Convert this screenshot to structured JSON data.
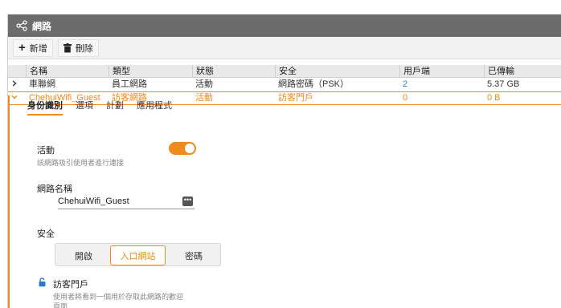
{
  "window": {
    "title": "網路"
  },
  "toolbar": {
    "add_label": "新增",
    "delete_label": "刪除"
  },
  "table": {
    "columns": [
      "名稱",
      "類型",
      "狀態",
      "安全",
      "用戶端",
      "已傳輸"
    ],
    "rows": [
      {
        "name": "車聯網",
        "type": "員工網路",
        "status": "活動",
        "security": "網路密碼（PSK）",
        "clients": "2",
        "transferred": "5.37 GB"
      },
      {
        "name": "ChehuiWifi_Guest",
        "type": "訪客網路",
        "status": "活動",
        "security": "訪客門戶",
        "clients": "0",
        "transferred": "0 B"
      }
    ]
  },
  "detail": {
    "tabs": [
      "身份識別",
      "選項",
      "計劃",
      "應用程式"
    ],
    "active_label": "活動",
    "active_hint": "該網路吸引使用者進行連接",
    "active_state": "on",
    "network_name_label": "網路名稱",
    "network_name_value": "ChehuiWifi_Guest",
    "security_label": "安全",
    "security_options": [
      "開啟",
      "入口網站",
      "密碼"
    ],
    "security_selected": "入口網站",
    "portal_title": "訪客門戶",
    "portal_hint_1": "使用者將看到一個用於存取此網路的歡迎",
    "portal_hint_2": "頁面"
  },
  "colors": {
    "accent": "#f08a1d",
    "titlebar": "#6c6c6c",
    "link": "#2d7bc4"
  }
}
